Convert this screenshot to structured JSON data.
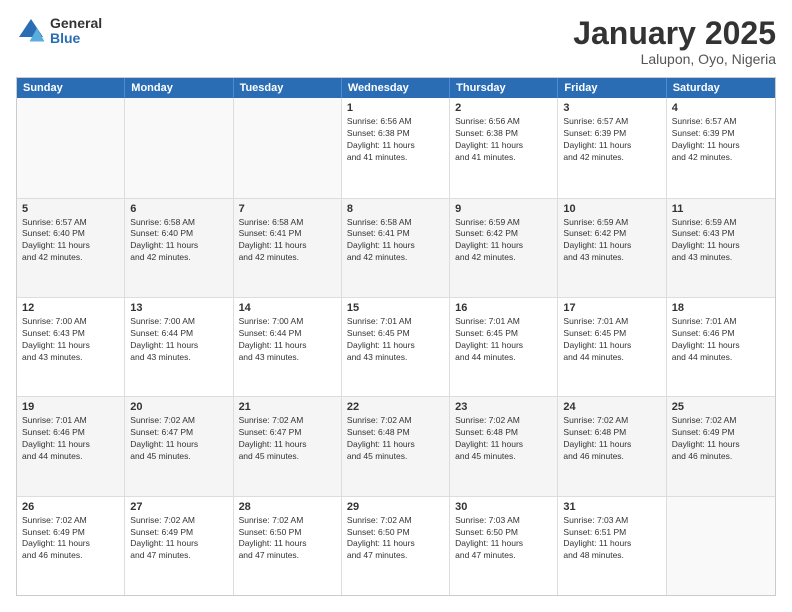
{
  "logo": {
    "general": "General",
    "blue": "Blue"
  },
  "title": "January 2025",
  "subtitle": "Lalupon, Oyo, Nigeria",
  "days": [
    "Sunday",
    "Monday",
    "Tuesday",
    "Wednesday",
    "Thursday",
    "Friday",
    "Saturday"
  ],
  "weeks": [
    [
      {
        "day": "",
        "info": ""
      },
      {
        "day": "",
        "info": ""
      },
      {
        "day": "",
        "info": ""
      },
      {
        "day": "1",
        "info": "Sunrise: 6:56 AM\nSunset: 6:38 PM\nDaylight: 11 hours\nand 41 minutes."
      },
      {
        "day": "2",
        "info": "Sunrise: 6:56 AM\nSunset: 6:38 PM\nDaylight: 11 hours\nand 41 minutes."
      },
      {
        "day": "3",
        "info": "Sunrise: 6:57 AM\nSunset: 6:39 PM\nDaylight: 11 hours\nand 42 minutes."
      },
      {
        "day": "4",
        "info": "Sunrise: 6:57 AM\nSunset: 6:39 PM\nDaylight: 11 hours\nand 42 minutes."
      }
    ],
    [
      {
        "day": "5",
        "info": "Sunrise: 6:57 AM\nSunset: 6:40 PM\nDaylight: 11 hours\nand 42 minutes."
      },
      {
        "day": "6",
        "info": "Sunrise: 6:58 AM\nSunset: 6:40 PM\nDaylight: 11 hours\nand 42 minutes."
      },
      {
        "day": "7",
        "info": "Sunrise: 6:58 AM\nSunset: 6:41 PM\nDaylight: 11 hours\nand 42 minutes."
      },
      {
        "day": "8",
        "info": "Sunrise: 6:58 AM\nSunset: 6:41 PM\nDaylight: 11 hours\nand 42 minutes."
      },
      {
        "day": "9",
        "info": "Sunrise: 6:59 AM\nSunset: 6:42 PM\nDaylight: 11 hours\nand 42 minutes."
      },
      {
        "day": "10",
        "info": "Sunrise: 6:59 AM\nSunset: 6:42 PM\nDaylight: 11 hours\nand 43 minutes."
      },
      {
        "day": "11",
        "info": "Sunrise: 6:59 AM\nSunset: 6:43 PM\nDaylight: 11 hours\nand 43 minutes."
      }
    ],
    [
      {
        "day": "12",
        "info": "Sunrise: 7:00 AM\nSunset: 6:43 PM\nDaylight: 11 hours\nand 43 minutes."
      },
      {
        "day": "13",
        "info": "Sunrise: 7:00 AM\nSunset: 6:44 PM\nDaylight: 11 hours\nand 43 minutes."
      },
      {
        "day": "14",
        "info": "Sunrise: 7:00 AM\nSunset: 6:44 PM\nDaylight: 11 hours\nand 43 minutes."
      },
      {
        "day": "15",
        "info": "Sunrise: 7:01 AM\nSunset: 6:45 PM\nDaylight: 11 hours\nand 43 minutes."
      },
      {
        "day": "16",
        "info": "Sunrise: 7:01 AM\nSunset: 6:45 PM\nDaylight: 11 hours\nand 44 minutes."
      },
      {
        "day": "17",
        "info": "Sunrise: 7:01 AM\nSunset: 6:45 PM\nDaylight: 11 hours\nand 44 minutes."
      },
      {
        "day": "18",
        "info": "Sunrise: 7:01 AM\nSunset: 6:46 PM\nDaylight: 11 hours\nand 44 minutes."
      }
    ],
    [
      {
        "day": "19",
        "info": "Sunrise: 7:01 AM\nSunset: 6:46 PM\nDaylight: 11 hours\nand 44 minutes."
      },
      {
        "day": "20",
        "info": "Sunrise: 7:02 AM\nSunset: 6:47 PM\nDaylight: 11 hours\nand 45 minutes."
      },
      {
        "day": "21",
        "info": "Sunrise: 7:02 AM\nSunset: 6:47 PM\nDaylight: 11 hours\nand 45 minutes."
      },
      {
        "day": "22",
        "info": "Sunrise: 7:02 AM\nSunset: 6:48 PM\nDaylight: 11 hours\nand 45 minutes."
      },
      {
        "day": "23",
        "info": "Sunrise: 7:02 AM\nSunset: 6:48 PM\nDaylight: 11 hours\nand 45 minutes."
      },
      {
        "day": "24",
        "info": "Sunrise: 7:02 AM\nSunset: 6:48 PM\nDaylight: 11 hours\nand 46 minutes."
      },
      {
        "day": "25",
        "info": "Sunrise: 7:02 AM\nSunset: 6:49 PM\nDaylight: 11 hours\nand 46 minutes."
      }
    ],
    [
      {
        "day": "26",
        "info": "Sunrise: 7:02 AM\nSunset: 6:49 PM\nDaylight: 11 hours\nand 46 minutes."
      },
      {
        "day": "27",
        "info": "Sunrise: 7:02 AM\nSunset: 6:49 PM\nDaylight: 11 hours\nand 47 minutes."
      },
      {
        "day": "28",
        "info": "Sunrise: 7:02 AM\nSunset: 6:50 PM\nDaylight: 11 hours\nand 47 minutes."
      },
      {
        "day": "29",
        "info": "Sunrise: 7:02 AM\nSunset: 6:50 PM\nDaylight: 11 hours\nand 47 minutes."
      },
      {
        "day": "30",
        "info": "Sunrise: 7:03 AM\nSunset: 6:50 PM\nDaylight: 11 hours\nand 47 minutes."
      },
      {
        "day": "31",
        "info": "Sunrise: 7:03 AM\nSunset: 6:51 PM\nDaylight: 11 hours\nand 48 minutes."
      },
      {
        "day": "",
        "info": ""
      }
    ]
  ]
}
